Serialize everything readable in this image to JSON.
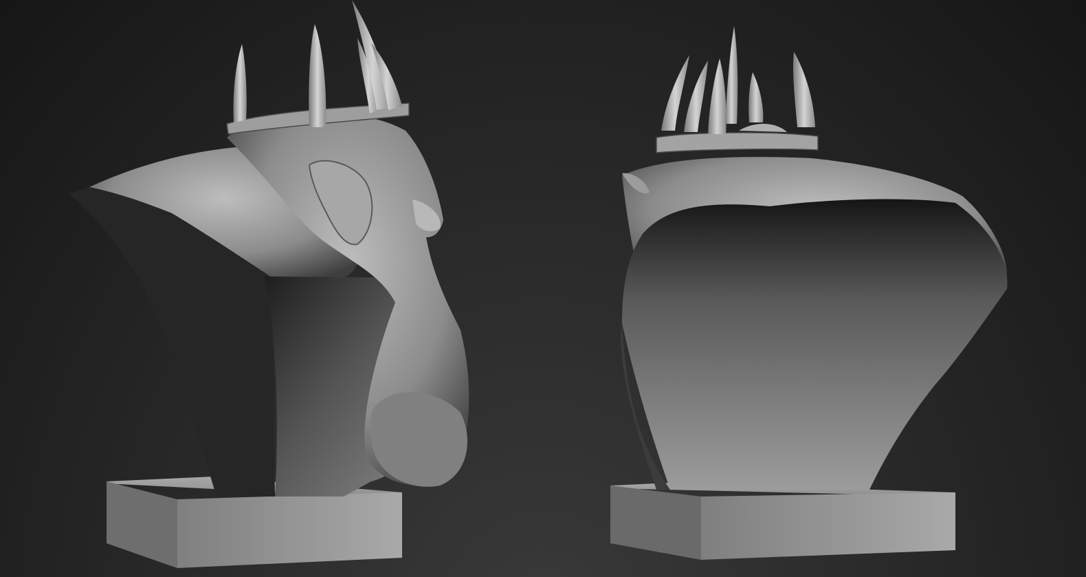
{
  "viewport": {
    "background_color": "#1e1e1e",
    "material_color": "#9a9a9a"
  },
  "views": [
    {
      "id": "side-view",
      "subject": "bust-sculpt",
      "orientation": "profile-right"
    },
    {
      "id": "back-view",
      "subject": "bust-sculpt",
      "orientation": "rear-three-quarter"
    }
  ]
}
